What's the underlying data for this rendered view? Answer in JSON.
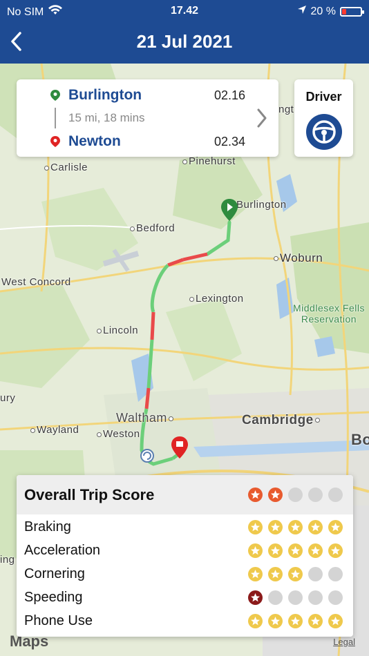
{
  "status_bar": {
    "carrier": "No SIM",
    "time": "17.42",
    "battery_percent": "20 %",
    "battery_level": 0.2,
    "icons": [
      "wifi-icon",
      "location-arrow-icon",
      "battery-icon"
    ]
  },
  "header": {
    "title": "21 Jul 2021",
    "back_icon": "chevron-left-icon",
    "background": "#1e4b93"
  },
  "trip": {
    "from": {
      "name": "Burlington",
      "time": "02.16"
    },
    "to": {
      "name": "Newton",
      "time": "02.34"
    },
    "summary": "15 mi, 18 mins"
  },
  "driver": {
    "label": "Driver",
    "icon": "steering-wheel-icon"
  },
  "map": {
    "places": [
      "Carlisle",
      "Pinehurst",
      "Burlington",
      "Bedford",
      "Woburn",
      "West Concord",
      "Lexington",
      "Middlesex Fells Reservation",
      "Lincoln",
      "ury",
      "Waltham",
      "Cambridge",
      "Bo",
      "Wayland",
      "Weston",
      "ing",
      "ngt"
    ],
    "maps_label": "Maps",
    "legal_label": "Legal",
    "colors": {
      "route_safe": "#6ccf7a",
      "route_alert": "#e94a4a",
      "start_pin": "#2e8b3e",
      "end_pin": "#e02424"
    }
  },
  "score": {
    "title": "Overall Trip Score",
    "overall": 2,
    "categories": [
      {
        "label": "Braking",
        "stars": 5,
        "style": "gold"
      },
      {
        "label": "Acceleration",
        "stars": 5,
        "style": "gold"
      },
      {
        "label": "Cornering",
        "stars": 3,
        "style": "gold"
      },
      {
        "label": "Speeding",
        "stars": 1,
        "style": "red"
      },
      {
        "label": "Phone Use",
        "stars": 5,
        "style": "gold"
      }
    ],
    "max_stars": 5,
    "colors": {
      "gold": "#efc94c",
      "orange": "#e85a2e",
      "red": "#8b1a1a",
      "empty": "#d4d4d4"
    }
  }
}
